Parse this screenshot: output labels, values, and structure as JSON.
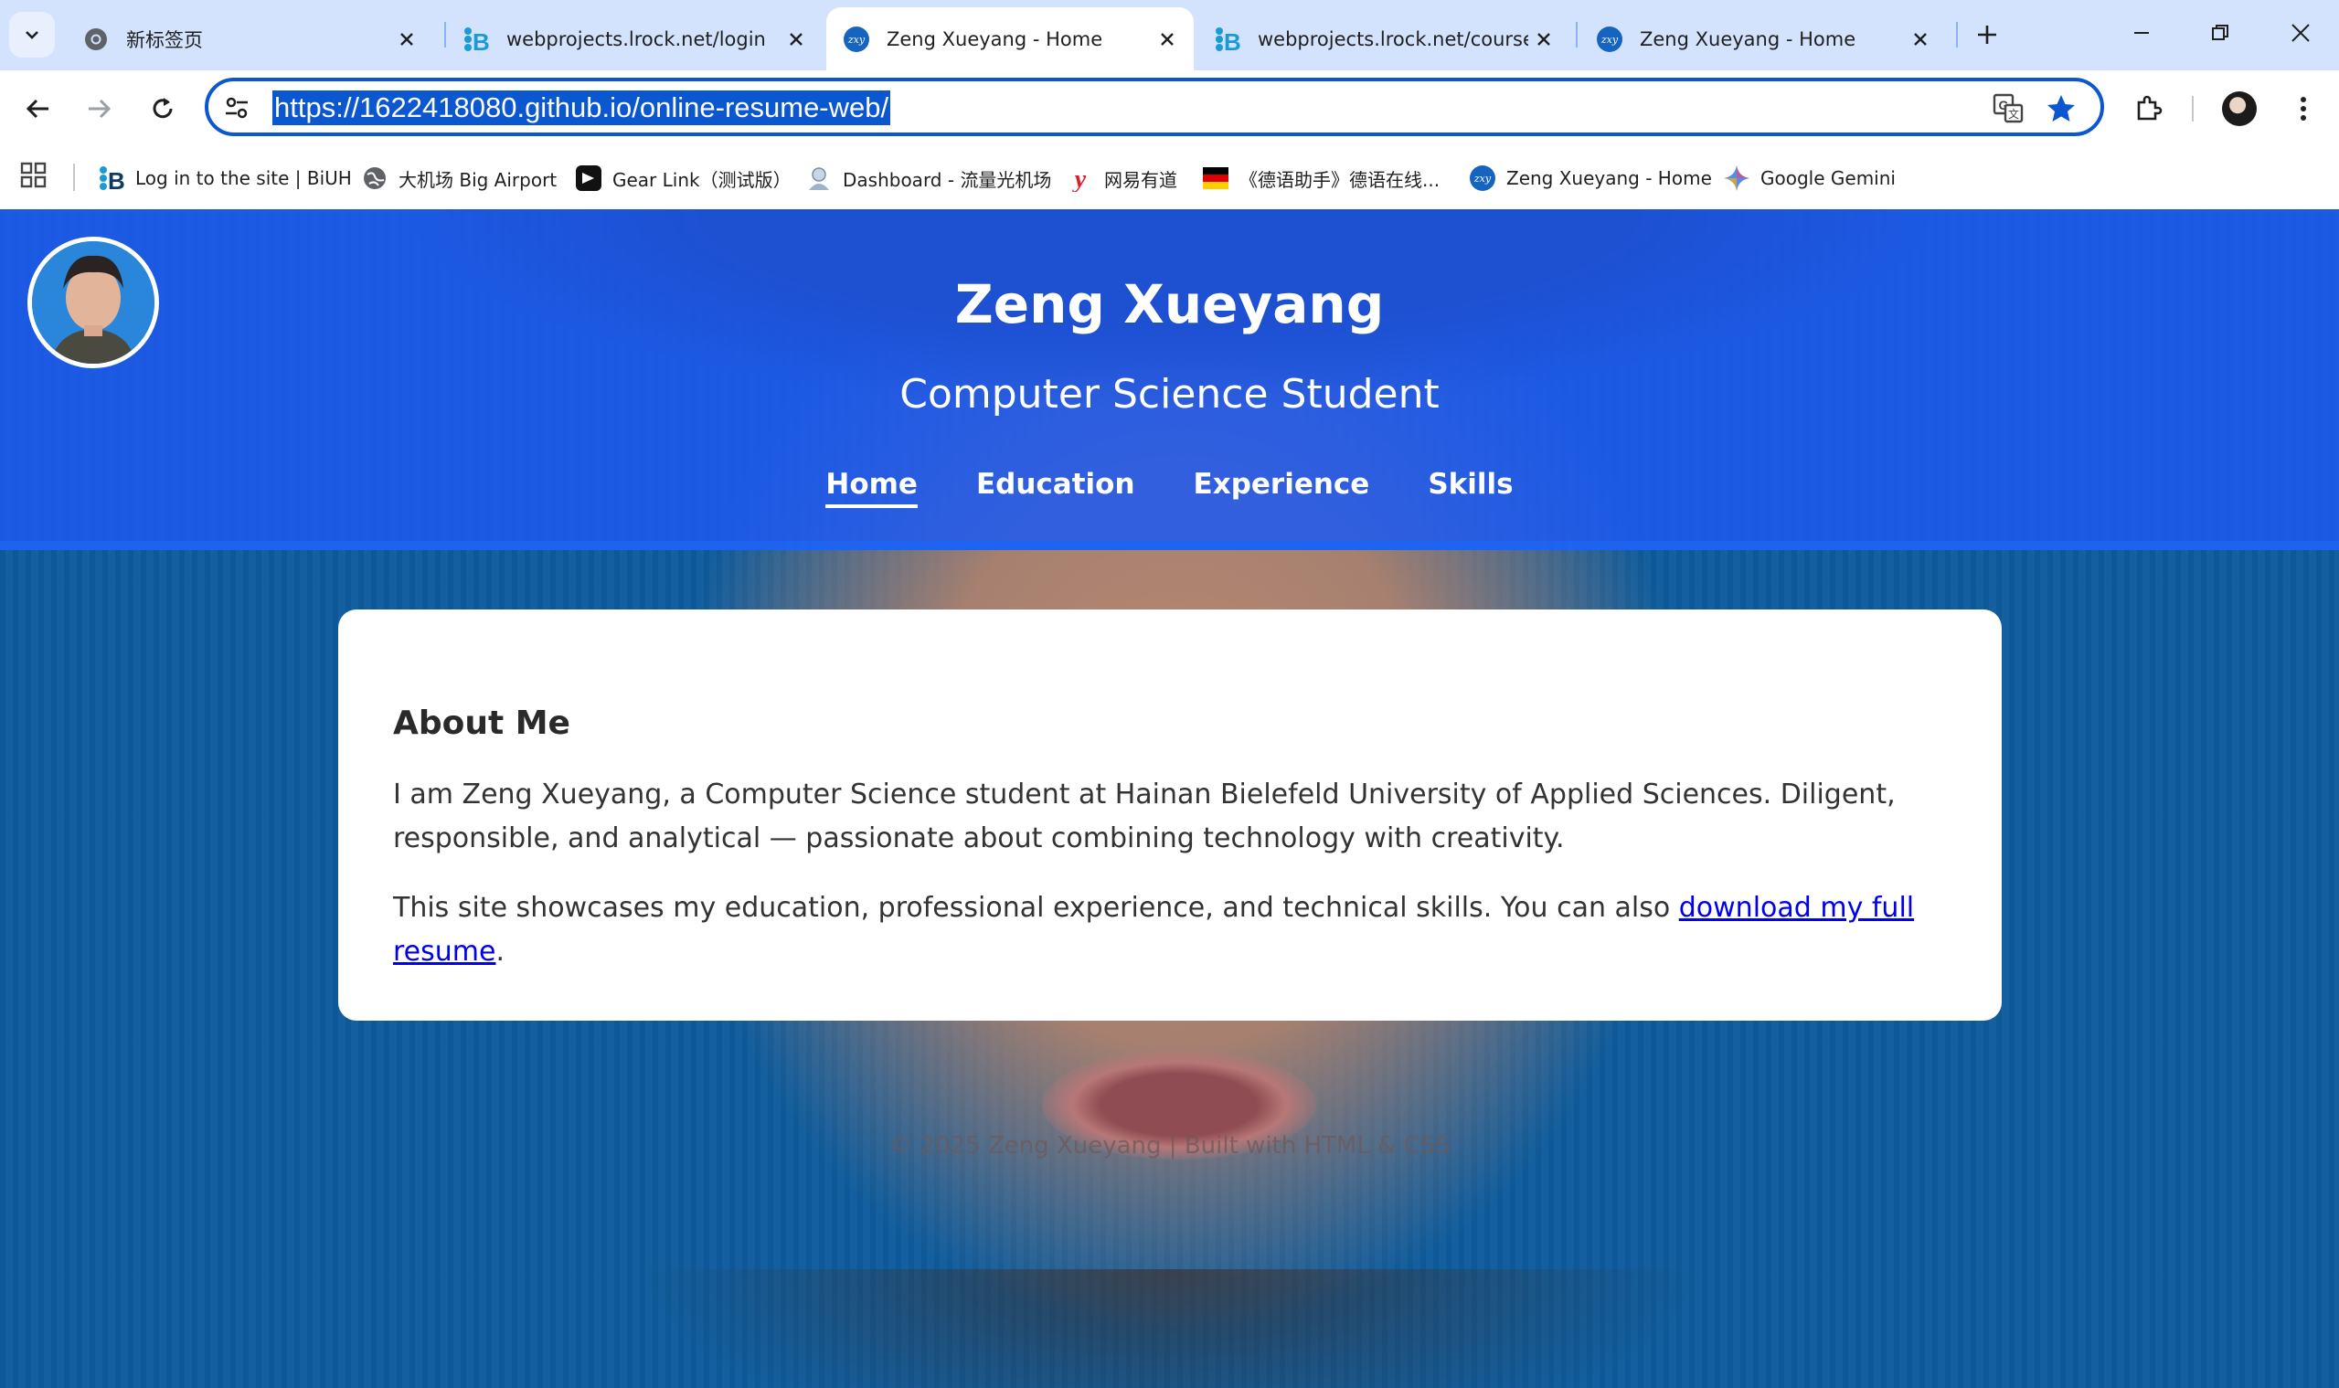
{
  "browser": {
    "tabs": [
      {
        "title": "新标签页",
        "favicon": "chrome-icon",
        "active": false
      },
      {
        "title": "webprojects.lrock.net/login",
        "favicon": "biuh-icon",
        "active": false
      },
      {
        "title": "Zeng Xueyang - Home",
        "favicon": "zxy-icon",
        "active": true
      },
      {
        "title": "webprojects.lrock.net/course",
        "favicon": "biuh-icon",
        "active": false
      },
      {
        "title": "Zeng Xueyang - Home",
        "favicon": "zxy-icon",
        "active": false
      }
    ],
    "url": "https://1622418080.github.io/online-resume-web/",
    "bookmarks": [
      {
        "label": "Log in to the site | BiUH",
        "icon": "biuh-icon"
      },
      {
        "label": "大机场 Big Airport",
        "icon": "globe-icon"
      },
      {
        "label": "Gear Link（测试版）",
        "icon": "gearlink-icon"
      },
      {
        "label": "Dashboard - 流量光机场",
        "icon": "dashboard-icon"
      },
      {
        "label": "网易有道",
        "icon": "youdao-icon"
      },
      {
        "label": "《德语助手》德语在线...",
        "icon": "german-flag-icon"
      },
      {
        "label": "Zeng Xueyang - Home",
        "icon": "zxy-icon"
      },
      {
        "label": "Google Gemini",
        "icon": "gemini-icon"
      }
    ],
    "accent": "#0b57d0",
    "tabstrip_color": "#d3e3fd"
  },
  "site": {
    "name": "Zeng Xueyang",
    "subtitle": "Computer Science Student",
    "nav": [
      {
        "label": "Home",
        "active": true
      },
      {
        "label": "Education",
        "active": false
      },
      {
        "label": "Experience",
        "active": false
      },
      {
        "label": "Skills",
        "active": false
      }
    ],
    "about": {
      "heading": "About Me",
      "p1": "I am Zeng Xueyang, a Computer Science student at Hainan Bielefeld University of Applied Sciences. Diligent, responsible, and analytical — passionate about combining technology with creativity.",
      "p2_before": "This site showcases my education, professional experience, and technical skills. You can also ",
      "p2_link": "download my full resume",
      "p2_after": "."
    },
    "footer": "© 2025 Zeng Xueyang | Built with HTML & CSS",
    "header_color": "#1e5af0",
    "link_color": "#0000ee"
  }
}
